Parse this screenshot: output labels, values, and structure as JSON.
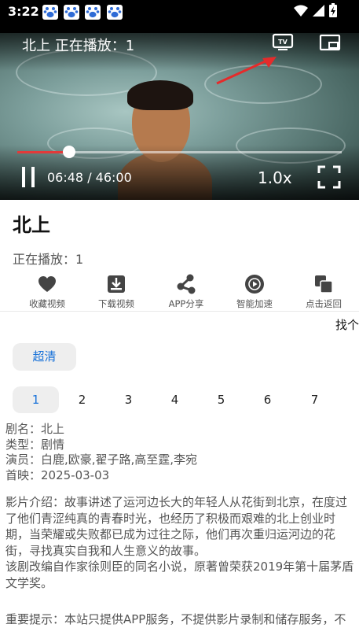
{
  "status_bar": {
    "time": "3:22",
    "notification_icons": [
      "baidu-paw-icon",
      "baidu-paw-icon",
      "baidu-paw-icon",
      "baidu-paw-icon"
    ],
    "system_icons": [
      "wifi-icon",
      "signal-icon",
      "battery-charging-icon"
    ]
  },
  "player": {
    "overlay_title": "北上 正在播放：1",
    "current_time": "06:48 / 46:00",
    "speed": "1.0x",
    "progress": 0.16,
    "accent_color": "#e23a3a"
  },
  "show": {
    "title": "北上",
    "now_playing": "正在播放：1"
  },
  "actions": [
    {
      "label": "收藏视频",
      "icon": "heart-icon"
    },
    {
      "label": "下载视频",
      "icon": "download-icon"
    },
    {
      "label": "APP分享",
      "icon": "share-icon"
    },
    {
      "label": "智能加速",
      "icon": "play-circle-icon"
    },
    {
      "label": "点击返回",
      "icon": "copy-icon"
    }
  ],
  "find_label": "找个",
  "quality_label": "超清",
  "episodes": [
    "1",
    "2",
    "3",
    "4",
    "5",
    "6",
    "7"
  ],
  "meta": {
    "name": "剧名：北上",
    "genre": "类型：剧情",
    "cast": "演员：白鹿,欧豪,翟子路,高至霆,李宛",
    "premiere": "首映：2025-03-03"
  },
  "description": {
    "intro": "影片介绍：故事讲述了运河边长大的年轻人从花街到北京，在度过了他们青涩纯真的青春时光，也经历了积极而艰难的北上创业时期，当荣耀或失败都已成为过往之际，他们再次重归运河边的花街，寻找真实自我和人生意义的故事。",
    "source": "该剧改编自作家徐则臣的同名小说，原著曾荣获2019年第十届茅盾文学奖。"
  },
  "notice": "重要提示：本站只提供APP服务，不提供影片录制和储存服务，不"
}
